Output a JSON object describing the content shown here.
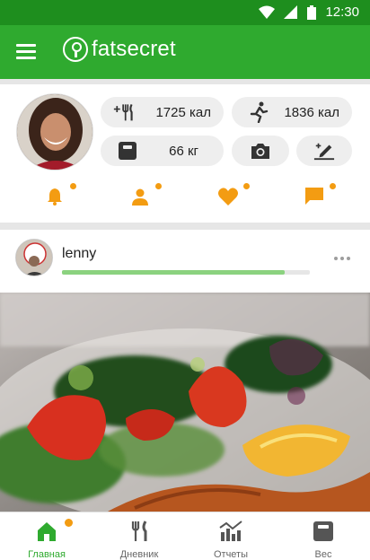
{
  "status_bar": {
    "time": "12:30"
  },
  "app_bar": {
    "brand": "fatsecret"
  },
  "profile": {
    "calories_in": "1725 кал",
    "calories_out": "1836 кал",
    "weight": "66 кг"
  },
  "feed": {
    "username": "lenny",
    "progress": 0.9
  },
  "bottom_nav": [
    {
      "label": "Главная"
    },
    {
      "label": "Дневник"
    },
    {
      "label": "Отчеты"
    },
    {
      "label": "Вес"
    }
  ],
  "colors": {
    "status_bar": "#1e8e1e",
    "app_bar": "#2faa2f",
    "accent": "#f39c12",
    "progress": "#8bd27f"
  }
}
